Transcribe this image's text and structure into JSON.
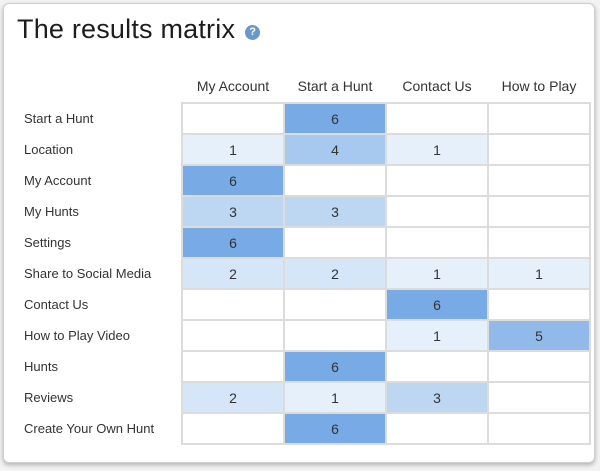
{
  "title": "The results matrix",
  "help_icon": "question-circle-icon",
  "columns": [
    "My Account",
    "Start a Hunt",
    "Contact Us",
    "How to Play"
  ],
  "rows": [
    {
      "label": "Start a Hunt",
      "values": [
        "",
        "6",
        "",
        ""
      ]
    },
    {
      "label": "Location",
      "values": [
        "1",
        "4",
        "1",
        ""
      ]
    },
    {
      "label": "My Account",
      "values": [
        "6",
        "",
        "",
        ""
      ]
    },
    {
      "label": "My Hunts",
      "values": [
        "3",
        "3",
        "",
        ""
      ]
    },
    {
      "label": "Settings",
      "values": [
        "6",
        "",
        "",
        ""
      ]
    },
    {
      "label": "Share to Social Media",
      "values": [
        "2",
        "2",
        "1",
        "1"
      ]
    },
    {
      "label": "Contact Us",
      "values": [
        "",
        "",
        "6",
        ""
      ]
    },
    {
      "label": "How to Play Video",
      "values": [
        "",
        "",
        "1",
        "5"
      ]
    },
    {
      "label": "Hunts",
      "values": [
        "",
        "6",
        "",
        ""
      ]
    },
    {
      "label": "Reviews",
      "values": [
        "2",
        "1",
        "3",
        ""
      ]
    },
    {
      "label": "Create Your Own Hunt",
      "values": [
        "",
        "6",
        "",
        ""
      ]
    }
  ],
  "colors": {
    "scale_low": "#e5f0fb",
    "scale_high": "#78aae6",
    "grid": "#dcdcdc"
  }
}
